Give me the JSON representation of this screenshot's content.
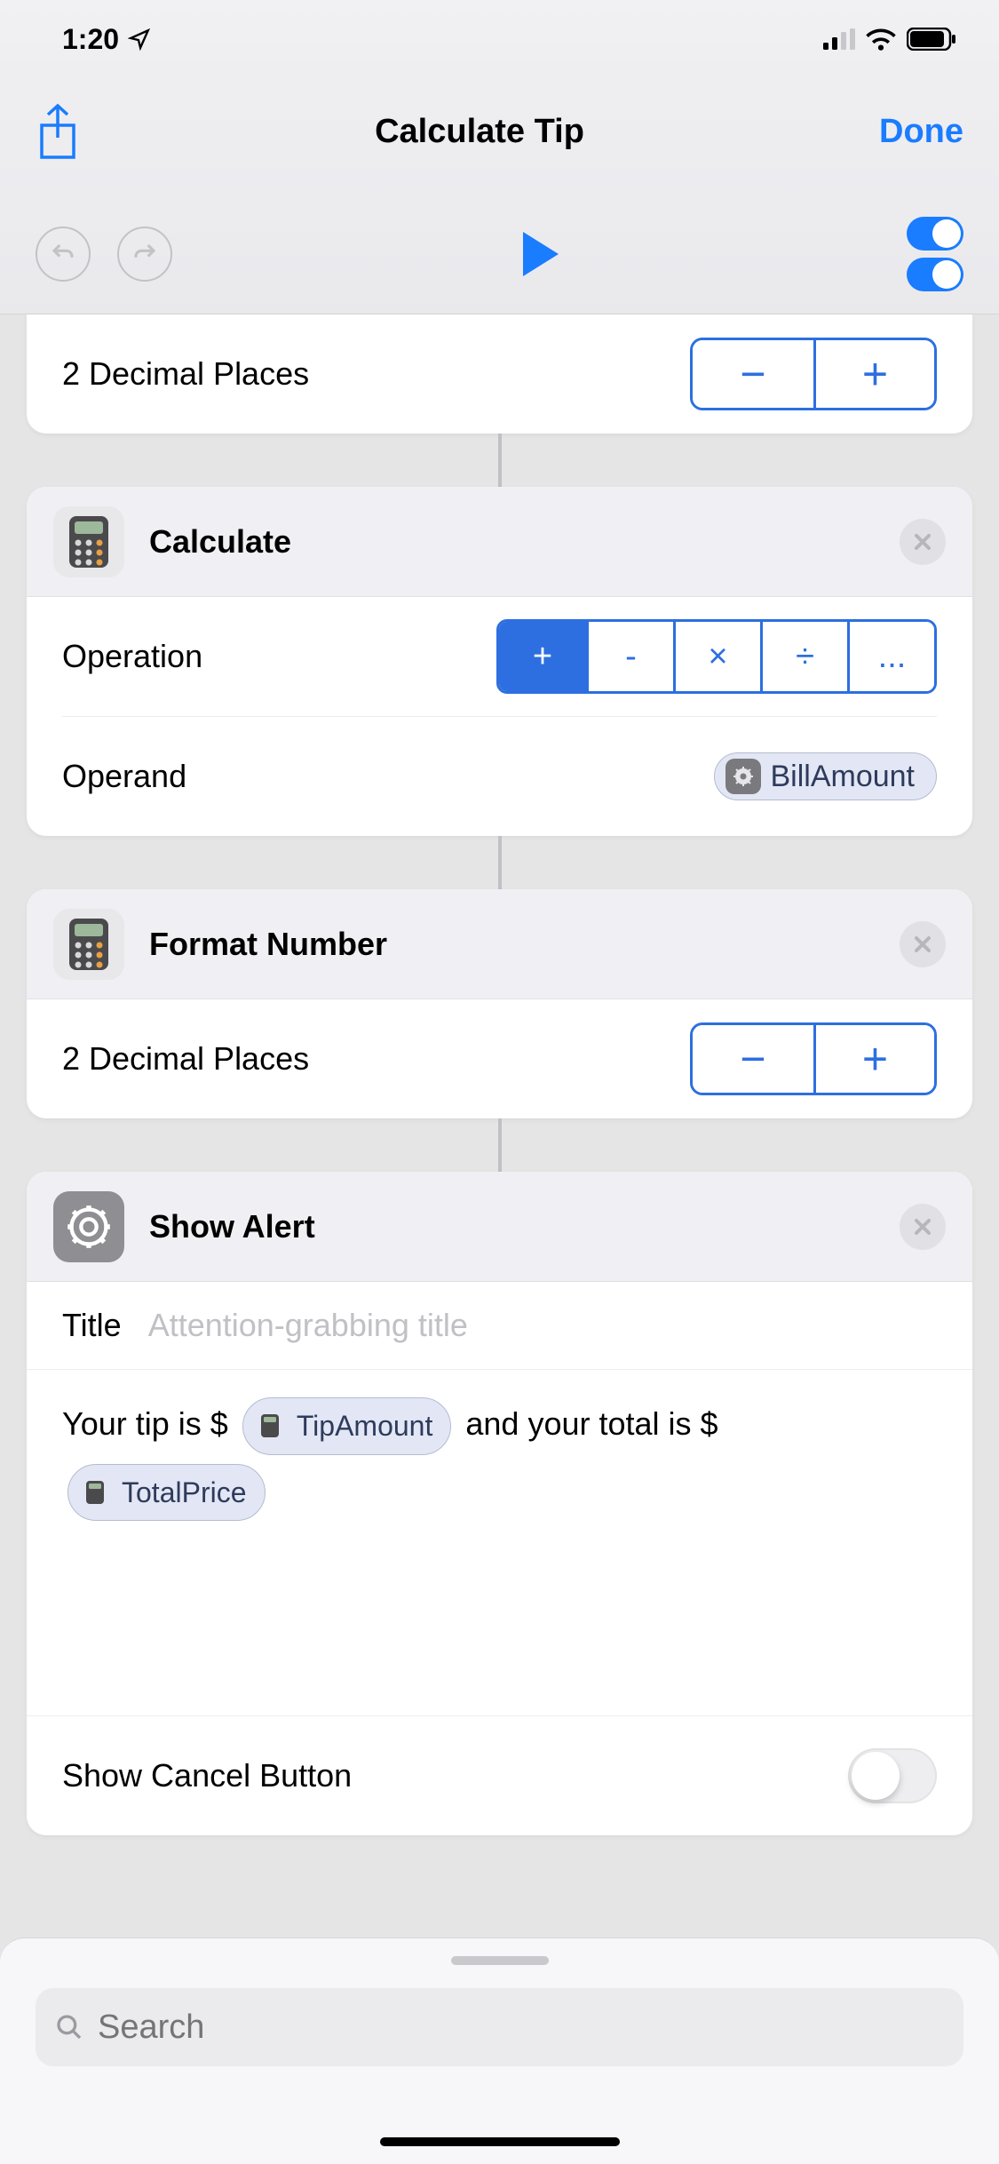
{
  "statusbar": {
    "time": "1:20"
  },
  "navbar": {
    "title": "Calculate Tip",
    "done": "Done"
  },
  "actions": {
    "decimal1": {
      "label": "2 Decimal Places"
    },
    "calculate": {
      "title": "Calculate",
      "operationLabel": "Operation",
      "operandLabel": "Operand",
      "operandToken": "BillAmount",
      "ops": {
        "add": "+",
        "sub": "-",
        "mul": "×",
        "div": "÷",
        "more": "..."
      }
    },
    "format": {
      "title": "Format Number",
      "decimalLabel": "2 Decimal Places"
    },
    "alert": {
      "title": "Show Alert",
      "titleLabel": "Title",
      "titlePlaceholder": "Attention-grabbing title",
      "msg1": "Your tip is $",
      "token1": "TipAmount",
      "msg2": "and your total is $",
      "token2": "TotalPrice",
      "cancelLabel": "Show Cancel Button"
    }
  },
  "search": {
    "placeholder": "Search"
  }
}
